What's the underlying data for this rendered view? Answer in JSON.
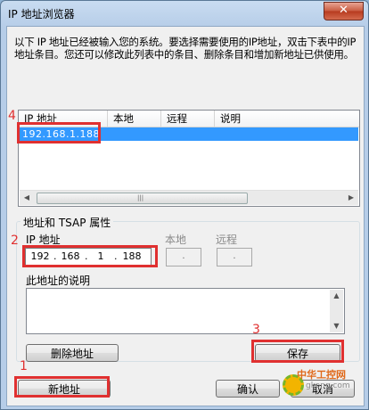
{
  "window": {
    "title": "IP 地址浏览器",
    "close_symbol": "✕"
  },
  "info_text": "以下 IP 地址已经被输入您的系统。要选择需要使用的IP地址，双击下表中的IP地址条目。您还可以修改此列表中的条目、删除条目和增加新地址已供使用。",
  "list": {
    "columns": [
      "IP 地址",
      "本地",
      "远程",
      "说明"
    ],
    "rows": [
      {
        "ip": "192.168.1.188",
        "local": "",
        "remote": "",
        "note": ""
      }
    ]
  },
  "properties": {
    "legend": "地址和 TSAP 属性",
    "ip_label": "IP 地址",
    "ip_octets": [
      "192",
      "168",
      "1",
      "188"
    ],
    "ip_dot": ".",
    "local_label": "本地",
    "local_value": ".",
    "remote_label": "远程",
    "remote_value": ".",
    "desc_label": "此地址的说明",
    "desc_value": ""
  },
  "buttons": {
    "delete": "删除地址",
    "save": "保存",
    "new": "新地址",
    "ok": "确认",
    "cancel": "取消"
  },
  "annotations": {
    "step1": "1",
    "step2": "2",
    "step3": "3",
    "step4": "4",
    "color": "#e03030"
  },
  "watermark": {
    "title": "中华工控网",
    "site": "gkong.com"
  }
}
